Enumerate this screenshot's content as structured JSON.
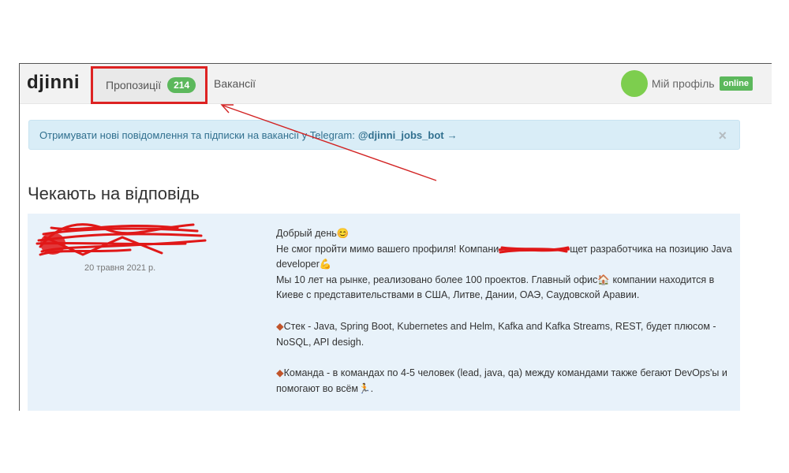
{
  "navbar": {
    "logo": "djinni",
    "tabs": [
      {
        "label": "Пропозиції",
        "badge": "214"
      },
      {
        "label": "Вакансії"
      }
    ],
    "profile": {
      "label": "Мій профіль",
      "status": "online"
    }
  },
  "alert": {
    "text": "Отримувати нові повідомлення та підписки на вакансії у Telegram:",
    "handle": "@djinni_jobs_bot",
    "arrow": "→",
    "close": "×"
  },
  "section": {
    "title": "Чекають на відповідь"
  },
  "message": {
    "date": "20 травня 2021 р.",
    "greeting": "Добрый день",
    "greeting_emoji": "😊",
    "line1a": "Не смог пройти мимо вашего профиля! Компани",
    "line1b": "щет разработчика на позицию Java developer",
    "line1_emoji": "💪",
    "line2a": "Мы 10 лет на рынке, реализовано более 100 проектов. Главный офис",
    "line2_emoji": "🏠",
    "line2b": "компании находится в Киеве с представительствами в США, Литве, Дании, ОАЭ, Саудовской Аравии.",
    "stack_marker": "◆",
    "stack": "Стек - Java, Spring Boot, Kubernetes and Helm, Kafka and Kafka Streams, REST, будет плюсом - NoSQL, API desigh.",
    "team_marker": "◆",
    "team": "Команда - в командах по 4-5 человек (lead, java, qa) между командами также бегают DevOps'ы и помогают во всём",
    "team_emoji": "🏃"
  },
  "colors": {
    "accent_green": "#5cb85c",
    "alert_bg": "#d9edf7",
    "card_bg": "#e8f2fa",
    "annotation_red": "#d22222"
  }
}
